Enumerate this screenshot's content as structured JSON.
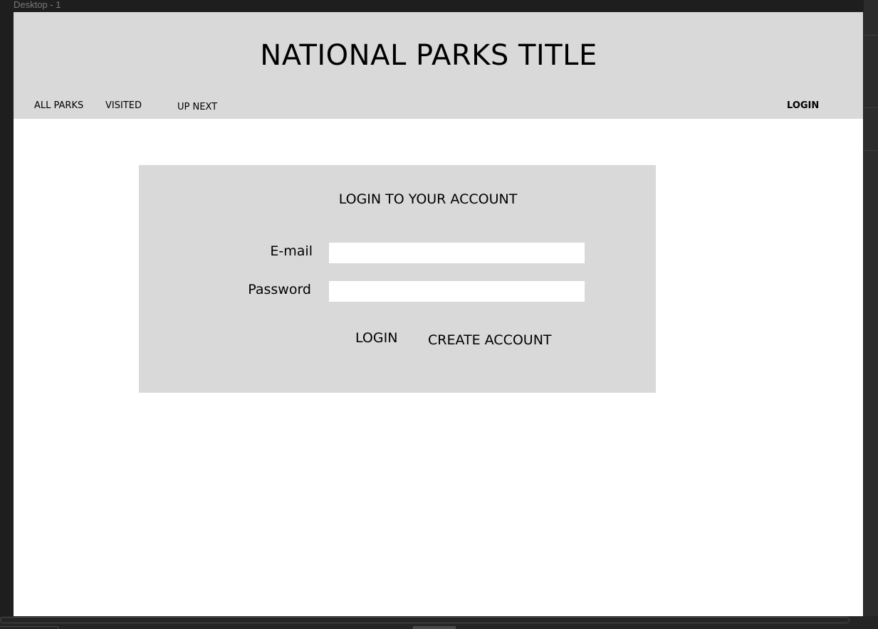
{
  "canvas": {
    "frame_label": "Desktop - 1"
  },
  "header": {
    "title": "NATIONAL PARKS TITLE",
    "nav": {
      "all_parks": "ALL PARKS",
      "visited": "VISITED",
      "up_next": "UP NEXT",
      "login": "LOGIN"
    }
  },
  "login_form": {
    "title": "LOGIN TO YOUR ACCOUNT",
    "email_label": "E-mail",
    "email_value": "",
    "password_label": "Password",
    "password_value": "",
    "login_button": "LOGIN",
    "create_account_button": "CREATE ACCOUNT"
  },
  "colors": {
    "canvas_background": "#1e1e1e",
    "panel_gray": "#d9d9d9",
    "frame_white": "#ffffff",
    "text": "#000000"
  }
}
